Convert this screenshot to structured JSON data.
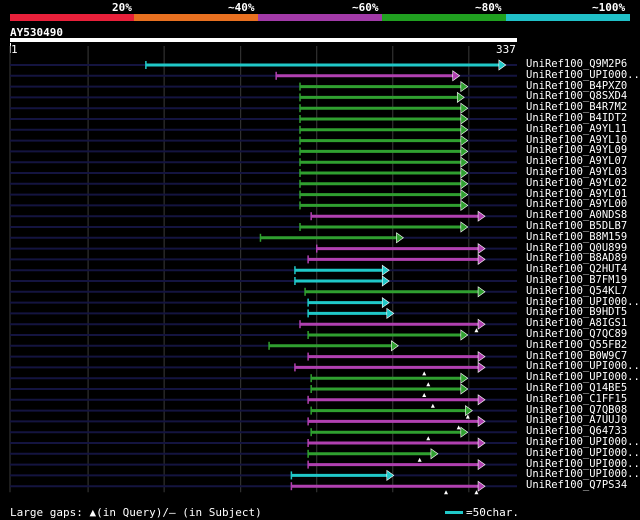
{
  "scale": {
    "labels": [
      "20%",
      "~40%",
      "~60%",
      "~80%",
      "~100%"
    ],
    "colors": [
      "#e8203a",
      "#e87020",
      "#a23aa8",
      "#20a020",
      "#20c0c8"
    ]
  },
  "query": {
    "name": "AY530490",
    "start": "1",
    "end": "337"
  },
  "colors": {
    "cyan": "#20c8c8",
    "magenta": "#b040b0",
    "green": "#30a030",
    "track": "#141440",
    "grid": "#3a3a3a"
  },
  "hits": [
    {
      "label": "UniRef100_Q9M2P6",
      "start": 0.268,
      "end": 0.978,
      "color": "cyan",
      "arrow": 0.978,
      "marks": []
    },
    {
      "label": "UniRef100_UPI000..",
      "start": 0.525,
      "end": 0.887,
      "color": "magenta",
      "arrow": 0.887,
      "marks": []
    },
    {
      "label": "UniRef100_B4PXZ0",
      "start": 0.572,
      "end": 0.903,
      "color": "green",
      "arrow": 0.903,
      "marks": []
    },
    {
      "label": "UniRef100_Q8SXD4",
      "start": 0.572,
      "end": 0.896,
      "color": "green",
      "arrow": 0.896,
      "marks": []
    },
    {
      "label": "UniRef100_B4R7M2",
      "start": 0.572,
      "end": 0.903,
      "color": "green",
      "arrow": 0.903,
      "marks": []
    },
    {
      "label": "UniRef100_B4IDT2",
      "start": 0.572,
      "end": 0.903,
      "color": "green",
      "arrow": 0.903,
      "marks": []
    },
    {
      "label": "UniRef100_A9YL11",
      "start": 0.572,
      "end": 0.903,
      "color": "green",
      "arrow": 0.903,
      "marks": []
    },
    {
      "label": "UniRef100_A9YL10",
      "start": 0.572,
      "end": 0.903,
      "color": "green",
      "arrow": 0.903,
      "marks": []
    },
    {
      "label": "UniRef100_A9YL09",
      "start": 0.572,
      "end": 0.903,
      "color": "green",
      "arrow": 0.903,
      "marks": []
    },
    {
      "label": "UniRef100_A9YL07",
      "start": 0.572,
      "end": 0.903,
      "color": "green",
      "arrow": 0.903,
      "marks": []
    },
    {
      "label": "UniRef100_A9YL03",
      "start": 0.572,
      "end": 0.903,
      "color": "green",
      "arrow": 0.903,
      "marks": []
    },
    {
      "label": "UniRef100_A9YL02",
      "start": 0.572,
      "end": 0.903,
      "color": "green",
      "arrow": 0.903,
      "marks": []
    },
    {
      "label": "UniRef100_A9YL01",
      "start": 0.572,
      "end": 0.903,
      "color": "green",
      "arrow": 0.903,
      "marks": []
    },
    {
      "label": "UniRef100_A9YL00",
      "start": 0.572,
      "end": 0.903,
      "color": "green",
      "arrow": 0.903,
      "marks": []
    },
    {
      "label": "UniRef100_A0NDS8",
      "start": 0.594,
      "end": 0.937,
      "color": "magenta",
      "arrow": 0.937,
      "marks": []
    },
    {
      "label": "UniRef100_B5DLB7",
      "start": 0.572,
      "end": 0.903,
      "color": "green",
      "arrow": 0.903,
      "marks": []
    },
    {
      "label": "UniRef100_B8M159",
      "start": 0.494,
      "end": 0.776,
      "color": "green",
      "arrow": 0.776,
      "marks": []
    },
    {
      "label": "UniRef100_Q0U899",
      "start": 0.605,
      "end": 0.937,
      "color": "magenta",
      "arrow": 0.937,
      "marks": []
    },
    {
      "label": "UniRef100_B8AD89",
      "start": 0.588,
      "end": 0.937,
      "color": "magenta",
      "arrow": 0.937,
      "marks": []
    },
    {
      "label": "UniRef100_Q2HUT4",
      "start": 0.562,
      "end": 0.748,
      "color": "cyan",
      "arrow": 0.748,
      "marks": []
    },
    {
      "label": "UniRef100_B7FM19",
      "start": 0.562,
      "end": 0.748,
      "color": "cyan",
      "arrow": 0.748,
      "marks": []
    },
    {
      "label": "UniRef100_Q54KL7",
      "start": 0.582,
      "end": 0.937,
      "color": "green",
      "arrow": 0.937,
      "marks": []
    },
    {
      "label": "UniRef100_UPI000..",
      "start": 0.588,
      "end": 0.748,
      "color": "cyan",
      "arrow": 0.748,
      "marks": []
    },
    {
      "label": "UniRef100_B9HDT5",
      "start": 0.588,
      "end": 0.757,
      "color": "cyan",
      "arrow": 0.757,
      "marks": []
    },
    {
      "label": "UniRef100_A8IGS1",
      "start": 0.572,
      "end": 0.937,
      "color": "magenta",
      "arrow": 0.937,
      "marks": [
        0.92
      ]
    },
    {
      "label": "UniRef100_Q7QC89",
      "start": 0.588,
      "end": 0.903,
      "color": "green",
      "arrow": 0.903,
      "marks": []
    },
    {
      "label": "UniRef100_Q55FB2",
      "start": 0.511,
      "end": 0.766,
      "color": "green",
      "arrow": 0.766,
      "marks": []
    },
    {
      "label": "UniRef100_B0W9C7",
      "start": 0.588,
      "end": 0.937,
      "color": "magenta",
      "arrow": 0.937,
      "marks": []
    },
    {
      "label": "UniRef100_UPI000..",
      "start": 0.562,
      "end": 0.937,
      "color": "magenta",
      "arrow": 0.937,
      "marks": [
        0.817
      ]
    },
    {
      "label": "UniRef100_UPI000..",
      "start": 0.594,
      "end": 0.903,
      "color": "green",
      "arrow": 0.903,
      "marks": [
        0.825
      ]
    },
    {
      "label": "UniRef100_Q14BE5",
      "start": 0.594,
      "end": 0.903,
      "color": "green",
      "arrow": 0.903,
      "marks": [
        0.817
      ]
    },
    {
      "label": "UniRef100_C1FF15",
      "start": 0.588,
      "end": 0.937,
      "color": "magenta",
      "arrow": 0.937,
      "marks": [
        0.834
      ]
    },
    {
      "label": "UniRef100_Q7QB08",
      "start": 0.594,
      "end": 0.912,
      "color": "green",
      "arrow": 0.912,
      "marks": [
        0.903
      ]
    },
    {
      "label": "UniRef100_A7UUJ0",
      "start": 0.588,
      "end": 0.937,
      "color": "magenta",
      "arrow": 0.937,
      "marks": [
        0.885
      ]
    },
    {
      "label": "UniRef100_Q64733",
      "start": 0.594,
      "end": 0.903,
      "color": "green",
      "arrow": 0.903,
      "marks": [
        0.825
      ]
    },
    {
      "label": "UniRef100_UPI000..",
      "start": 0.588,
      "end": 0.937,
      "color": "magenta",
      "arrow": 0.937,
      "marks": []
    },
    {
      "label": "UniRef100_UPI000..",
      "start": 0.588,
      "end": 0.844,
      "color": "green",
      "arrow": 0.844,
      "marks": [
        0.808
      ]
    },
    {
      "label": "UniRef100_UPI000..",
      "start": 0.588,
      "end": 0.937,
      "color": "magenta",
      "arrow": 0.937,
      "marks": []
    },
    {
      "label": "UniRef100_UPI000..",
      "start": 0.555,
      "end": 0.757,
      "color": "cyan",
      "arrow": 0.757,
      "marks": []
    },
    {
      "label": "UniRef100_Q7PS34",
      "start": 0.555,
      "end": 0.937,
      "color": "magenta",
      "arrow": 0.937,
      "marks": [
        0.86,
        0.92
      ]
    }
  ],
  "footer": {
    "gaps_prefix": "Large gaps:",
    "gaps_query": "(in Query)/",
    "gaps_subject": "(in Subject)",
    "scale_text": "=50char."
  }
}
